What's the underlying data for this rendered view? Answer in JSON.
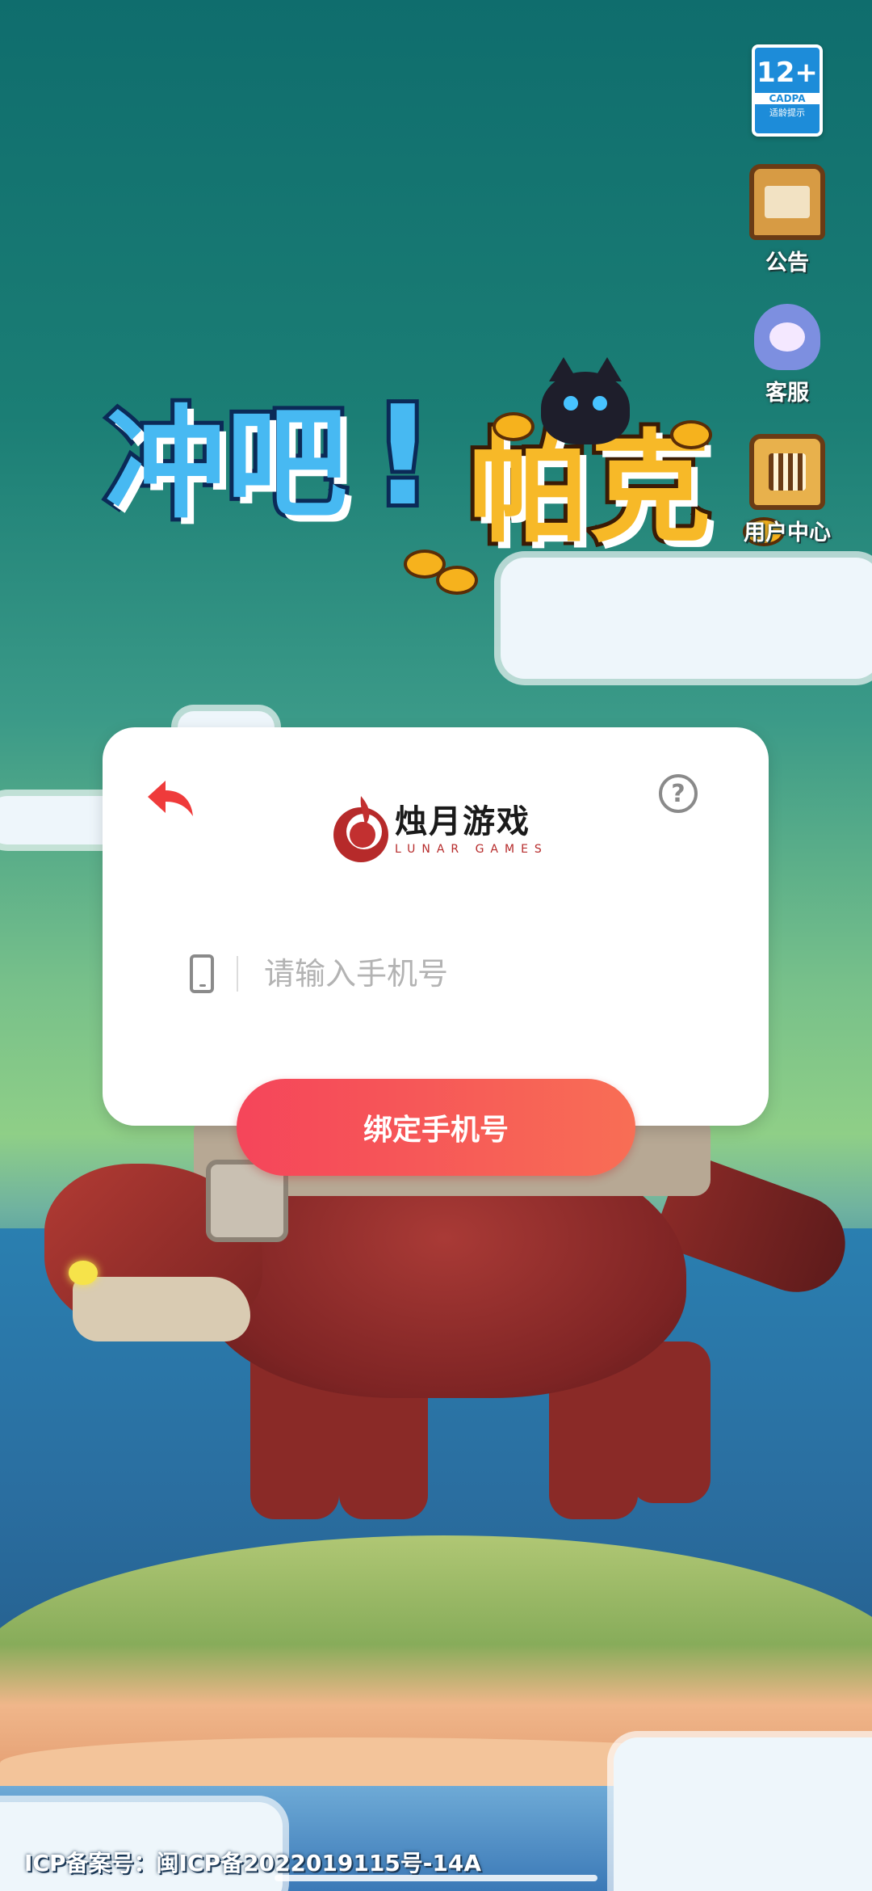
{
  "app": {
    "logo_text_part1": "冲吧",
    "logo_bang": "!",
    "logo_text_part2": "帕克"
  },
  "age_rating": {
    "age": "12+",
    "org": "CADPA",
    "tip": "适龄提示"
  },
  "side_menu": {
    "items": [
      {
        "label": "公告",
        "icon": "notice-board-icon"
      },
      {
        "label": "客服",
        "icon": "customer-service-icon"
      },
      {
        "label": "用户中心",
        "icon": "user-center-icon"
      }
    ]
  },
  "dialog": {
    "brand_cn": "烛月游戏",
    "brand_en": "LUNAR GAMES",
    "help_symbol": "?",
    "phone_placeholder": "请输入手机号",
    "phone_value": "",
    "bind_button_label": "绑定手机号"
  },
  "footer": {
    "icp": "ICP备案号：闽ICP备2022019115号-14A"
  },
  "colors": {
    "accent_red": "#f5455a",
    "accent_orange": "#f86e55",
    "brand_red": "#b62a2a"
  }
}
